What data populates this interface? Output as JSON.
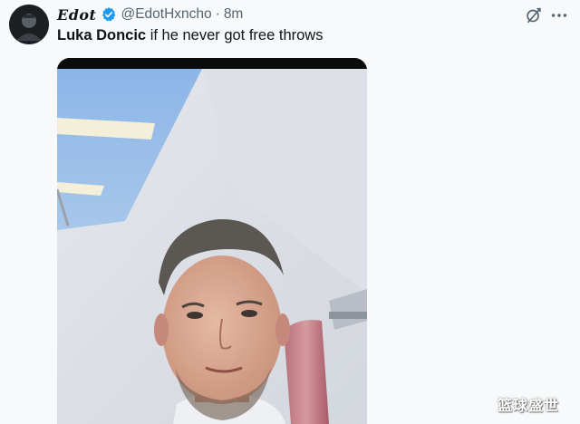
{
  "tweet": {
    "author": {
      "display_name": "Edot",
      "verified": true,
      "handle": "@EdotHxncho",
      "time_separator": "·",
      "time": "8m"
    },
    "text": {
      "bold": "Luka Doncic",
      "rest": " if he never got free throws"
    },
    "media": {
      "type": "photo"
    },
    "actions": {
      "grok_icon": "grok-icon",
      "more_icon": "more-icon"
    }
  },
  "watermark": "篮球盛世",
  "colors": {
    "background": "#f7f9fa",
    "text_primary": "#0f1419",
    "text_secondary": "#536471",
    "verified_badge": "#1d9bf0"
  }
}
